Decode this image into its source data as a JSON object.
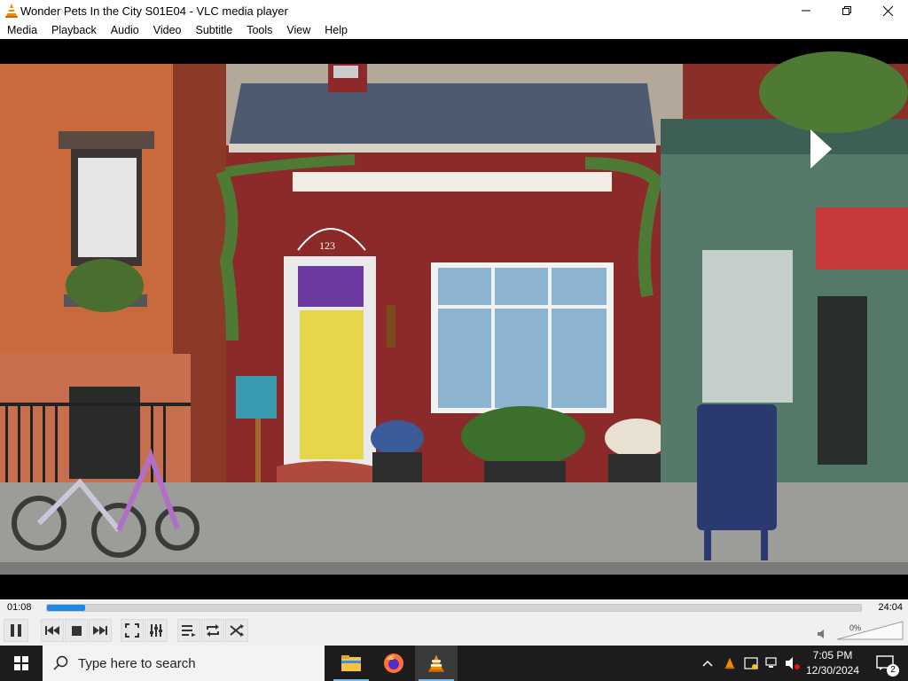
{
  "window": {
    "title": "Wonder Pets In the City S01E04 - VLC media player"
  },
  "menu": [
    "Media",
    "Playback",
    "Audio",
    "Video",
    "Subtitle",
    "Tools",
    "View",
    "Help"
  ],
  "video": {
    "door_number": "123"
  },
  "playback": {
    "elapsed": "01:08",
    "total": "24:04",
    "progress": 0.047,
    "state": "playing"
  },
  "volume": {
    "percent_label": "0%",
    "muted": true
  },
  "taskbar": {
    "search_placeholder": "Type here to search",
    "pinned": [
      "file-explorer",
      "firefox",
      "vlc"
    ],
    "active_app": "vlc",
    "clock_time": "7:05 PM",
    "clock_date": "12/30/2024",
    "notification_count": "2"
  },
  "colors": {
    "accent_progress": "#1e88e5",
    "vlc_orange": "#f08a00",
    "taskbar_bg": "#1c1c1c"
  }
}
